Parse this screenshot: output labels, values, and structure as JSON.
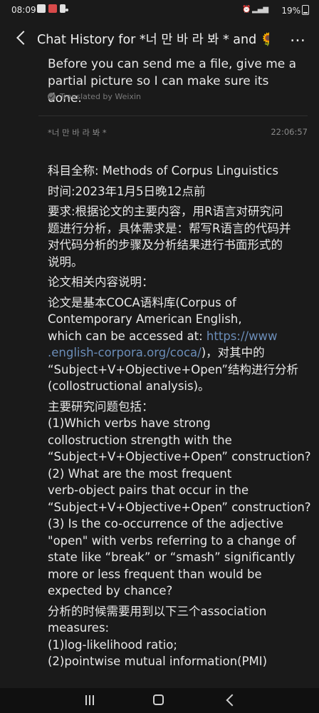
{
  "status_bar": {
    "time": "08:09",
    "battery": "19%"
  },
  "header": {
    "title": "Chat History for *너 만 바 라 봐 * and 🌻",
    "more": "…"
  },
  "messages": [
    {
      "text": "Before you can send me a file, give me a partial picture so I can make sure its done.",
      "translated_note": "Translated by Weixin"
    },
    {
      "sender": "*너 만 바 라 봐 *",
      "time": "22:06:57",
      "lines": {
        "l1": "科目全称: Methods of Corpus Linguistics",
        "l2": "时间:2023年1月5日晚12点前",
        "l3": "要求:根据论文的主要内容，用R语言对研究问",
        "l4": "题进行分析，具体需求是：帮写R语言的代码并",
        "l5": "对代码分析的步骤及分析结果进行书面形式的",
        "l6": "说明。",
        "l7": "论文相关内容说明：",
        "l8": "论文是基本COCA语料库(Corpus of",
        "l9": "Contemporary American English,",
        "l10a": "which can be accessed at: ",
        "l10b": "https://www",
        "l11a": ".english-corpora.org/coca/",
        "l11b": ")，对其中的",
        "l12": "“Subject+V+Objective+Open”结构进行分析",
        "l13": "(collostructional analysis)。",
        "l14": "主要研究问题包括：",
        "l15": "(1)Which verbs have strong",
        "l16": "collostruction strength with the",
        "l17": "“Subject+V+Objective+Open” construction?",
        "l18": "(2) What are the most frequent",
        "l19": "verb-object pairs that occur in the",
        "l20": "“Subject+V+Objective+Open” construction?",
        "l21": "(3) Is the co-occurrence of the adjective",
        "l22": "\"open\" with verbs referring to a change of",
        "l23": "state like “break” or “smash” significantly",
        "l24": "more or less frequent than would be",
        "l25": "expected by chance?",
        "l26": "分析的时候需要用到以下三个association",
        "l27": "measures:",
        "l28": "(1)log-likelihood ratio;",
        "l29": "(2)pointwise mutual information(PMI)"
      }
    }
  ]
}
